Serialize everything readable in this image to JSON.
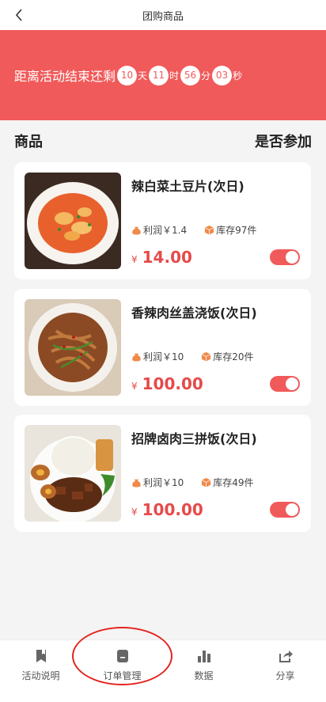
{
  "header": {
    "title": "团购商品",
    "back_icon": "chevron-left-icon"
  },
  "banner": {
    "prefix": "距离活动结束还剩",
    "days": "10",
    "days_unit": "天",
    "hours": "11",
    "hours_unit": "时",
    "minutes": "56",
    "minutes_unit": "分",
    "seconds": "03",
    "seconds_unit": "秒",
    "bg_color": "#f15a5a"
  },
  "section": {
    "left": "商品",
    "right": "是否参加"
  },
  "products": [
    {
      "name": "辣白菜土豆片(次日)",
      "profit": "利润￥1.4",
      "stock": "库存97件",
      "currency": "¥",
      "price": "14.00",
      "participating": true
    },
    {
      "name": "香辣肉丝盖浇饭(次日)",
      "profit": "利润￥10",
      "stock": "库存20件",
      "currency": "¥",
      "price": "100.00",
      "participating": true
    },
    {
      "name": "招牌卤肉三拼饭(次日)",
      "profit": "利润￥10",
      "stock": "库存49件",
      "currency": "¥",
      "price": "100.00",
      "participating": true
    }
  ],
  "tabbar": [
    {
      "label": "活动说明",
      "icon": "bookmark-icon"
    },
    {
      "label": "订单管理",
      "icon": "order-icon"
    },
    {
      "label": "数据",
      "icon": "bar-chart-icon"
    },
    {
      "label": "分享",
      "icon": "share-icon"
    }
  ],
  "accent": "#e64a4a"
}
